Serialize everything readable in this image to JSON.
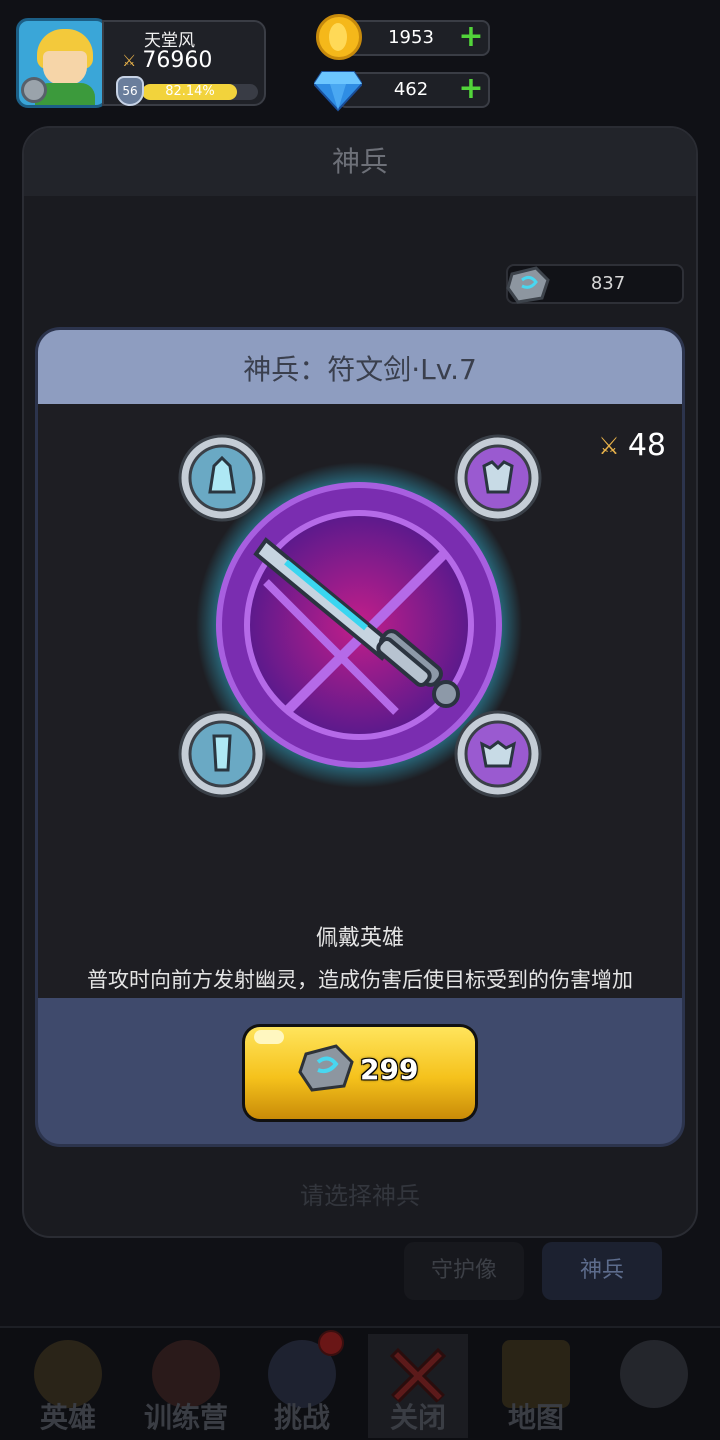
{
  "player": {
    "name": "天堂风",
    "power": "76960",
    "level": "56",
    "xp_percent_text": "82.14%",
    "xp_fraction": 0.8214
  },
  "currencies": {
    "gold": "1953",
    "diamonds": "462"
  },
  "background_panel": {
    "title": "神兵",
    "rune_stones": "837",
    "hint": "请选择神兵",
    "tabs": [
      "守护像",
      "神兵"
    ]
  },
  "modal": {
    "title": "神兵：符文剑·Lv.7",
    "power": "48",
    "slots": [
      "cloak-icon",
      "armor-icon",
      "boots-icon",
      "helmet-icon"
    ],
    "equip_title": "佩戴英雄",
    "equip_desc": "普攻时向前方发射幽灵，造成伤害后使目标受到的伤害增加",
    "upgrade_cost": "299"
  },
  "bottom_nav": [
    {
      "label": "英雄",
      "icon": "heroes-icon"
    },
    {
      "label": "训练营",
      "icon": "training-camp-icon"
    },
    {
      "label": "挑战",
      "icon": "challenge-icon"
    },
    {
      "label": "关闭",
      "icon": "close-icon"
    },
    {
      "label": "地图",
      "icon": "map-icon"
    },
    {
      "label": "",
      "icon": "locked-icon"
    }
  ],
  "colors": {
    "accent_gold": "#f5c21c",
    "panel_blue": "#3f4a6c",
    "header_blue": "#8e9dc0",
    "plus_green": "#52d43a",
    "emblem_purple": "#8a2fb8",
    "glow_cyan": "#37d6ff"
  }
}
